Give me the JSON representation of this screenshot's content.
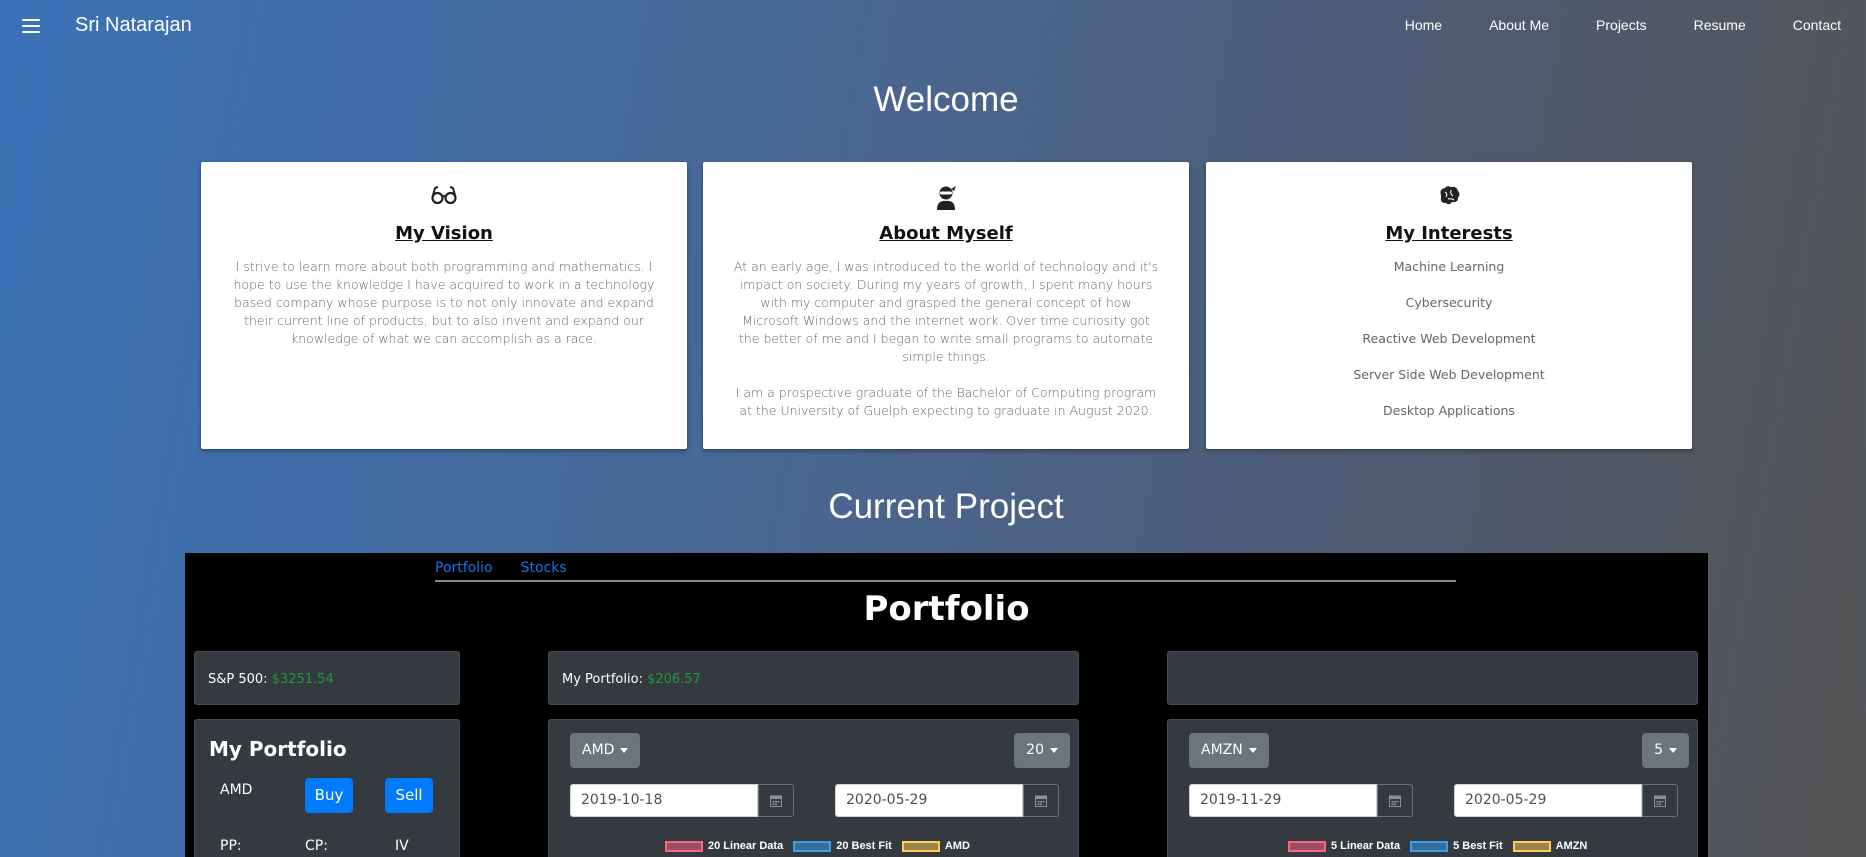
{
  "nav": {
    "brand": "Sri Natarajan",
    "links": [
      "Home",
      "About Me",
      "Projects",
      "Resume",
      "Contact"
    ]
  },
  "welcome": {
    "title": "Welcome",
    "cards": [
      {
        "title": "My Vision",
        "icon": "glasses-icon",
        "text": "I strive to learn more about both programming and mathematics. I hope to use the knowledge I have acquired to work in a technology based company whose purpose is to not only innovate and expand their current line of products, but to also invent and expand our knowledge of what we can accomplish as a race."
      },
      {
        "title": "About Myself",
        "icon": "user-ninja-icon",
        "text": "At an early age, I was introduced to the world of technology and it's impact on society. During my years of growth, I spent many hours with my computer and grasped the general concept of how Microsoft Windows and the internet work. Over time curiosity got the better of me and I began to write small programs to automate simple things.",
        "text2": "I am a prospective graduate of the Bachelor of Computing program at the University of Guelph expecting to graduate in August 2020."
      },
      {
        "title": "My Interests",
        "icon": "brain-icon",
        "items": [
          "Machine Learning",
          "Cybersecurity",
          "Reactive Web Development",
          "Server Side Web Development",
          "Desktop Applications"
        ]
      }
    ]
  },
  "project": {
    "title": "Current Project",
    "tabs": [
      "Portfolio",
      "Stocks"
    ],
    "heading": "Portfolio",
    "sp500": {
      "label": "S&P 500: ",
      "value": "$3251.54"
    },
    "my_portfolio": {
      "label": "My Portfolio: ",
      "value": "$206.57"
    },
    "sidebar": {
      "title": "My Portfolio",
      "stock": "AMD",
      "buy": "Buy",
      "sell": "Sell",
      "pp": "PP:",
      "cp": "CP:",
      "iv": "IV"
    },
    "chart1": {
      "symbol": "AMD",
      "period": "20",
      "start": "2019-10-18",
      "end": "2020-05-29",
      "legend": [
        "20 Linear Data",
        "20 Best Fit",
        "AMD"
      ]
    },
    "chart2": {
      "symbol": "AMZN",
      "period": "5",
      "start": "2019-11-29",
      "end": "2020-05-29",
      "legend": [
        "5 Linear Data",
        "5 Best Fit",
        "AMZN"
      ]
    },
    "colors": {
      "linear": "#ff6384",
      "bestfit": "#36a2eb",
      "symbol": "#ffce56"
    }
  }
}
